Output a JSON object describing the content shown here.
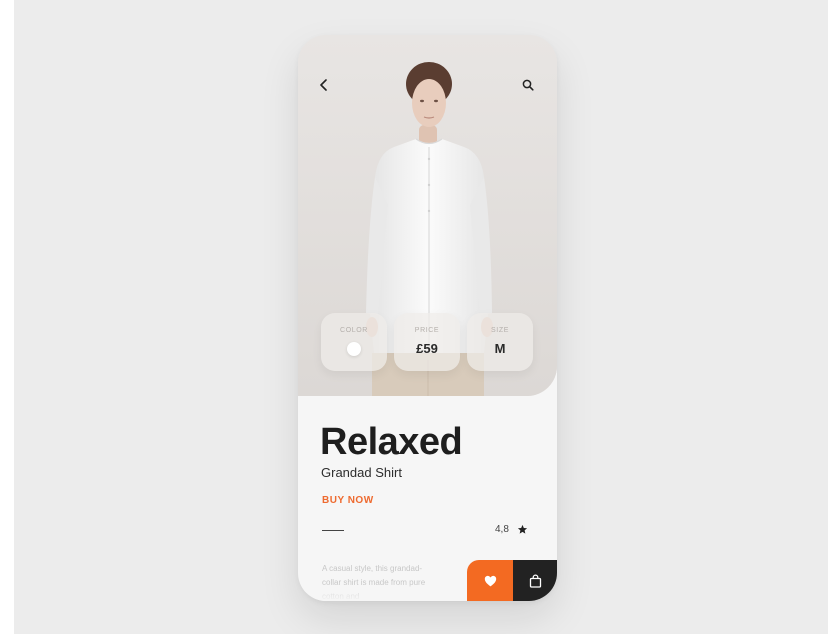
{
  "screen": {
    "accent_color": "#f36a22",
    "dark_color": "#222222",
    "background_color": "#ececec"
  },
  "header": {
    "back_icon": "chevron-left-icon",
    "search_icon": "search-icon"
  },
  "attributes": [
    {
      "label": "COLOR",
      "swatch_color": "#ffffff"
    },
    {
      "label": "PRICE",
      "value": "£59"
    },
    {
      "label": "SIZE",
      "value": "M"
    }
  ],
  "product": {
    "title": "Relaxed",
    "subtitle": "Grandad Shirt",
    "buy_now_label": "BUY NOW",
    "rating": "4,8",
    "rating_icon": "star-icon",
    "description": "A casual style, this grandad-collar shirt is made from pure cotton and"
  },
  "actions": {
    "favorite_icon": "heart-icon",
    "bag_icon": "shopping-bag-icon"
  }
}
